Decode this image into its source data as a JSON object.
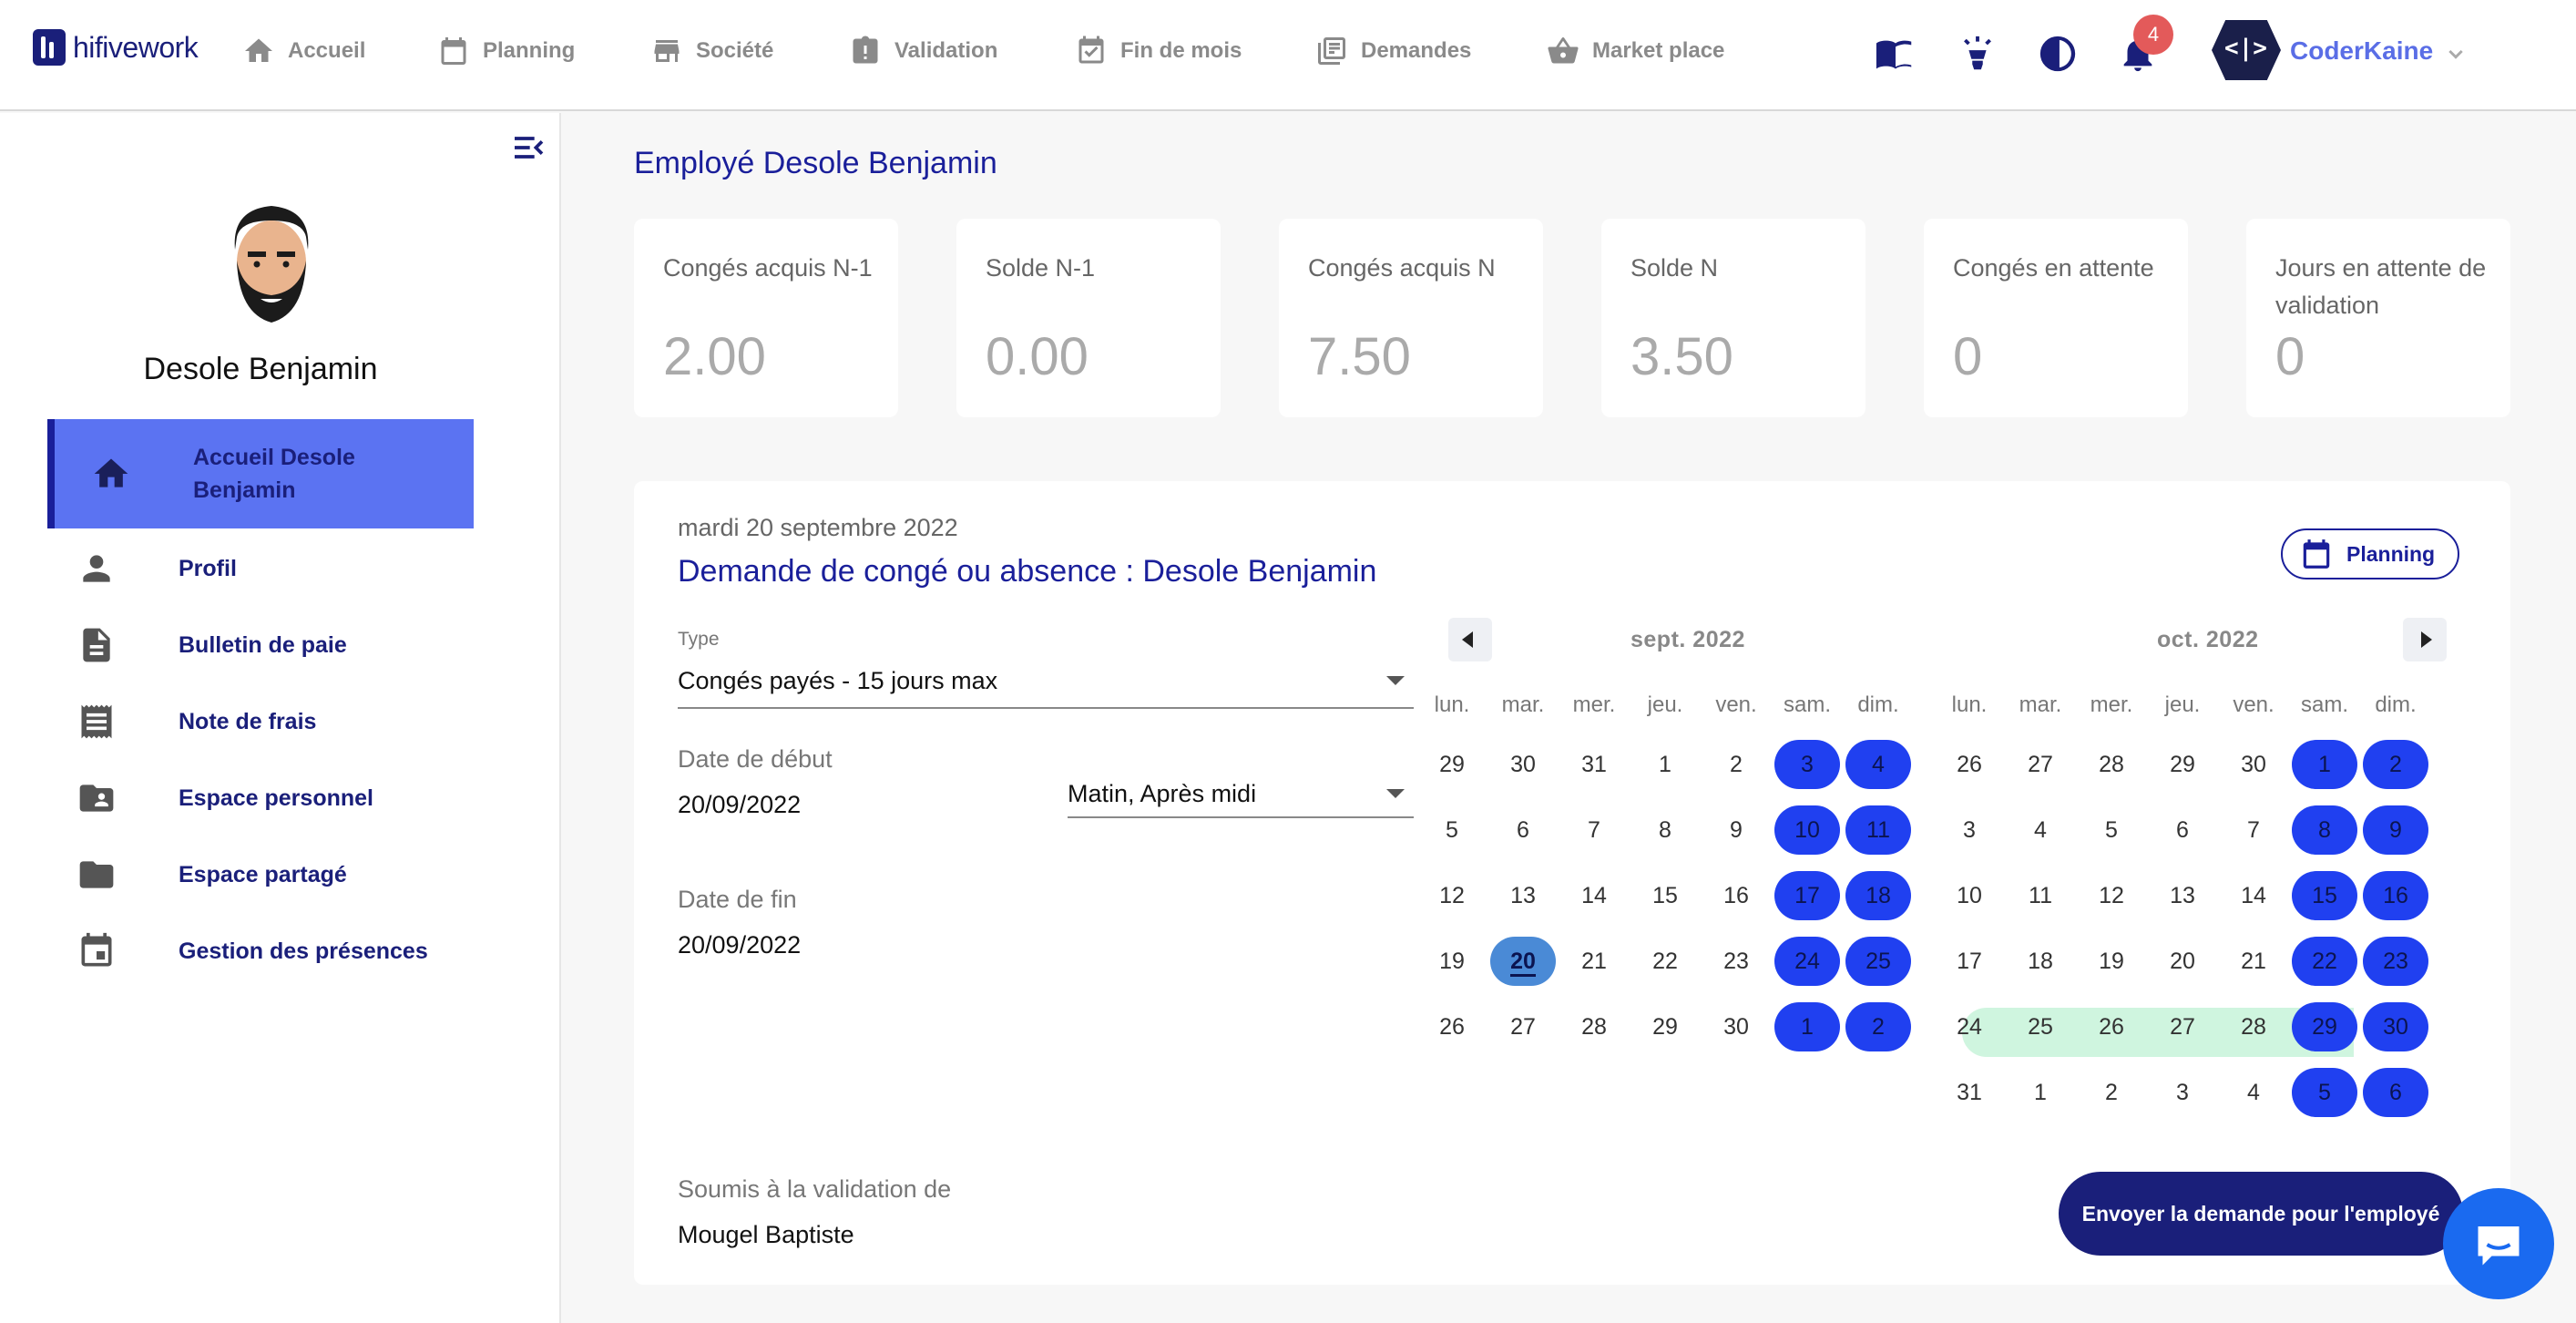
{
  "app": {
    "logo_text": "hifivework",
    "nav": [
      {
        "label": "Accueil",
        "icon": "home-icon"
      },
      {
        "label": "Planning",
        "icon": "calendar-icon"
      },
      {
        "label": "Société",
        "icon": "store-icon"
      },
      {
        "label": "Validation",
        "icon": "clipboard-alert-icon"
      },
      {
        "label": "Fin de mois",
        "icon": "calendar-check-icon"
      },
      {
        "label": "Demandes",
        "icon": "stacked-pages-icon"
      },
      {
        "label": "Market place",
        "icon": "basket-icon"
      }
    ],
    "notifications_count": "4",
    "user": {
      "avatar_text": "<|>",
      "name": "CoderKaine"
    }
  },
  "sidebar": {
    "employee_name": "Desole Benjamin",
    "items": [
      {
        "label": "Accueil Desole Benjamin",
        "icon": "home-icon",
        "active": true
      },
      {
        "label": "Profil",
        "icon": "person-icon"
      },
      {
        "label": "Bulletin de paie",
        "icon": "document-icon"
      },
      {
        "label": "Note de frais",
        "icon": "receipt-icon"
      },
      {
        "label": "Espace personnel",
        "icon": "contact-folder-icon"
      },
      {
        "label": "Espace partagé",
        "icon": "folder-icon"
      },
      {
        "label": "Gestion des présences",
        "icon": "calendar-list-icon"
      }
    ]
  },
  "main": {
    "title": "Employé Desole Benjamin",
    "stats": [
      {
        "label": "Congés acquis N-1",
        "value": "2.00"
      },
      {
        "label": "Solde N-1",
        "value": "0.00"
      },
      {
        "label": "Congés acquis N",
        "value": "7.50"
      },
      {
        "label": "Solde N",
        "value": "3.50"
      },
      {
        "label": "Congés en attente",
        "value": "0"
      },
      {
        "label": "Jours en attente de validation",
        "value": "0"
      }
    ],
    "request": {
      "date": "mardi 20 septembre 2022",
      "title": "Demande de congé ou absence : Desole Benjamin",
      "planning_label": "Planning",
      "type_label": "Type",
      "type_value": "Congés payés - 15 jours max",
      "start_label": "Date de début",
      "start_value": "20/09/2022",
      "period_value": "Matin, Après midi",
      "end_label": "Date de fin",
      "end_value": "20/09/2022",
      "validator_label": "Soumis à la validation de",
      "validator_value": "Mougel Baptiste",
      "send_label": "Envoyer la demande pour l'employé"
    },
    "calendar": {
      "weekdays": [
        "lun.",
        "mar.",
        "mer.",
        "jeu.",
        "ven.",
        "sam.",
        "dim."
      ],
      "months": [
        {
          "title": "sept. 2022",
          "weeks": [
            [
              "29",
              "30",
              "31",
              "1",
              "2",
              "3",
              "4"
            ],
            [
              "5",
              "6",
              "7",
              "8",
              "9",
              "10",
              "11"
            ],
            [
              "12",
              "13",
              "14",
              "15",
              "16",
              "17",
              "18"
            ],
            [
              "19",
              "20",
              "21",
              "22",
              "23",
              "24",
              "25"
            ],
            [
              "26",
              "27",
              "28",
              "29",
              "30",
              "1",
              "2"
            ]
          ],
          "today": "20"
        },
        {
          "title": "oct. 2022",
          "weeks": [
            [
              "26",
              "27",
              "28",
              "29",
              "30",
              "1",
              "2"
            ],
            [
              "3",
              "4",
              "5",
              "6",
              "7",
              "8",
              "9"
            ],
            [
              "10",
              "11",
              "12",
              "13",
              "14",
              "15",
              "16"
            ],
            [
              "17",
              "18",
              "19",
              "20",
              "21",
              "22",
              "23"
            ],
            [
              "24",
              "25",
              "26",
              "27",
              "28",
              "29",
              "30"
            ],
            [
              "31",
              "1",
              "2",
              "3",
              "4",
              "5",
              "6"
            ]
          ]
        }
      ]
    }
  },
  "colors": {
    "brand_dark": "#1a1f7a",
    "accent": "#5b73f2",
    "weekend": "#2040f0",
    "today": "#4a8ad6",
    "range": "#cff5df"
  }
}
